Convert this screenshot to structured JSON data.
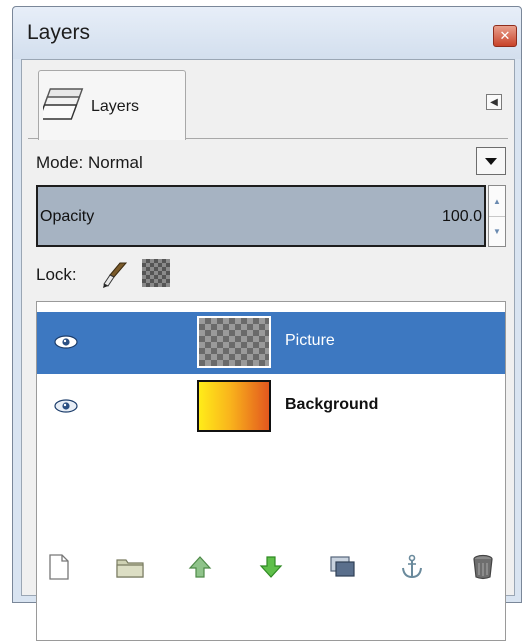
{
  "window": {
    "title": "Layers"
  },
  "tab": {
    "label": "Layers"
  },
  "mode": {
    "label": "Mode: Normal"
  },
  "opacity": {
    "label": "Opacity",
    "value": "100.0",
    "fraction": 1.0
  },
  "lock": {
    "label": "Lock:"
  },
  "layers": [
    {
      "name": "Picture",
      "selected": true,
      "visible": true,
      "thumbnail": "transparent-checker"
    },
    {
      "name": "Background",
      "selected": false,
      "visible": true,
      "thumbnail": "yellow-orange-gradient"
    }
  ],
  "toolbar": {
    "buttons": [
      "new-layer-icon",
      "new-layer-group-icon",
      "raise-layer-icon",
      "lower-layer-icon",
      "duplicate-layer-icon",
      "anchor-layer-icon",
      "delete-layer-icon"
    ]
  },
  "colors": {
    "selection": "#3d78c1",
    "titlebar": "#d9e4f1",
    "close": "#c8432a"
  }
}
